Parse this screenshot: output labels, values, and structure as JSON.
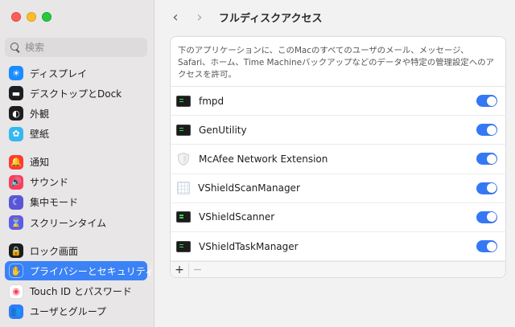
{
  "window": {
    "title": "フルディスクアクセス"
  },
  "sidebar": {
    "search_placeholder": "検索",
    "items": [
      {
        "label": "ディスプレイ",
        "icon": "display-icon",
        "color": "#1a8cff",
        "glyph": "☀"
      },
      {
        "label": "デスクトップとDock",
        "icon": "dock-icon",
        "color": "#1d1d1f",
        "glyph": "▬"
      },
      {
        "label": "外観",
        "icon": "appearance-icon",
        "color": "#1d1d1f",
        "glyph": "◐"
      },
      {
        "label": "壁紙",
        "icon": "wallpaper-icon",
        "color": "#35b7f0",
        "glyph": "✿"
      },
      {
        "label": "通知",
        "icon": "notifications-icon",
        "color": "#ff3b30",
        "glyph": "🔔"
      },
      {
        "label": "サウンド",
        "icon": "sound-icon",
        "color": "#ff3b5c",
        "glyph": "🔊"
      },
      {
        "label": "集中モード",
        "icon": "focus-icon",
        "color": "#5856d6",
        "glyph": "☾"
      },
      {
        "label": "スクリーンタイム",
        "icon": "screen-time-icon",
        "color": "#5e5ce6",
        "glyph": "⌛"
      },
      {
        "label": "ロック画面",
        "icon": "lock-icon",
        "color": "#1d1d1f",
        "glyph": "🔒"
      },
      {
        "label": "プライバシーとセキュリティ",
        "icon": "privacy-hand-icon",
        "color": "#2f7cf6",
        "glyph": "✋"
      },
      {
        "label": "Touch ID とパスワード",
        "icon": "fingerprint-icon",
        "color": "#ffffff",
        "glyph": "◉"
      },
      {
        "label": "ユーザとグループ",
        "icon": "users-icon",
        "color": "#2f7cf6",
        "glyph": "👥"
      }
    ]
  },
  "main": {
    "description": "下のアプリケーションに、このMacのすべてのユーザのメール、メッセージ、Safari、ホーム、Time Machineバックアップなどのデータや特定の管理設定へのアクセスを許可。",
    "apps": [
      {
        "name": "fmpd",
        "icon": "terminal-icon",
        "enabled": true
      },
      {
        "name": "GenUtility",
        "icon": "terminal-icon",
        "enabled": true
      },
      {
        "name": "McAfee Network Extension",
        "icon": "shield-icon",
        "enabled": true
      },
      {
        "name": "VShieldScanManager",
        "icon": "grid-document-icon",
        "enabled": true
      },
      {
        "name": "VShieldScanner",
        "icon": "terminal-icon",
        "enabled": true
      },
      {
        "name": "VShieldTaskManager",
        "icon": "terminal-icon",
        "enabled": true
      }
    ],
    "footer": {
      "add": "+",
      "remove": "−"
    }
  },
  "colors": {
    "accent": "#3478f6",
    "sidebar_bg": "#e8e6e7",
    "selected": "#3b82f6"
  }
}
